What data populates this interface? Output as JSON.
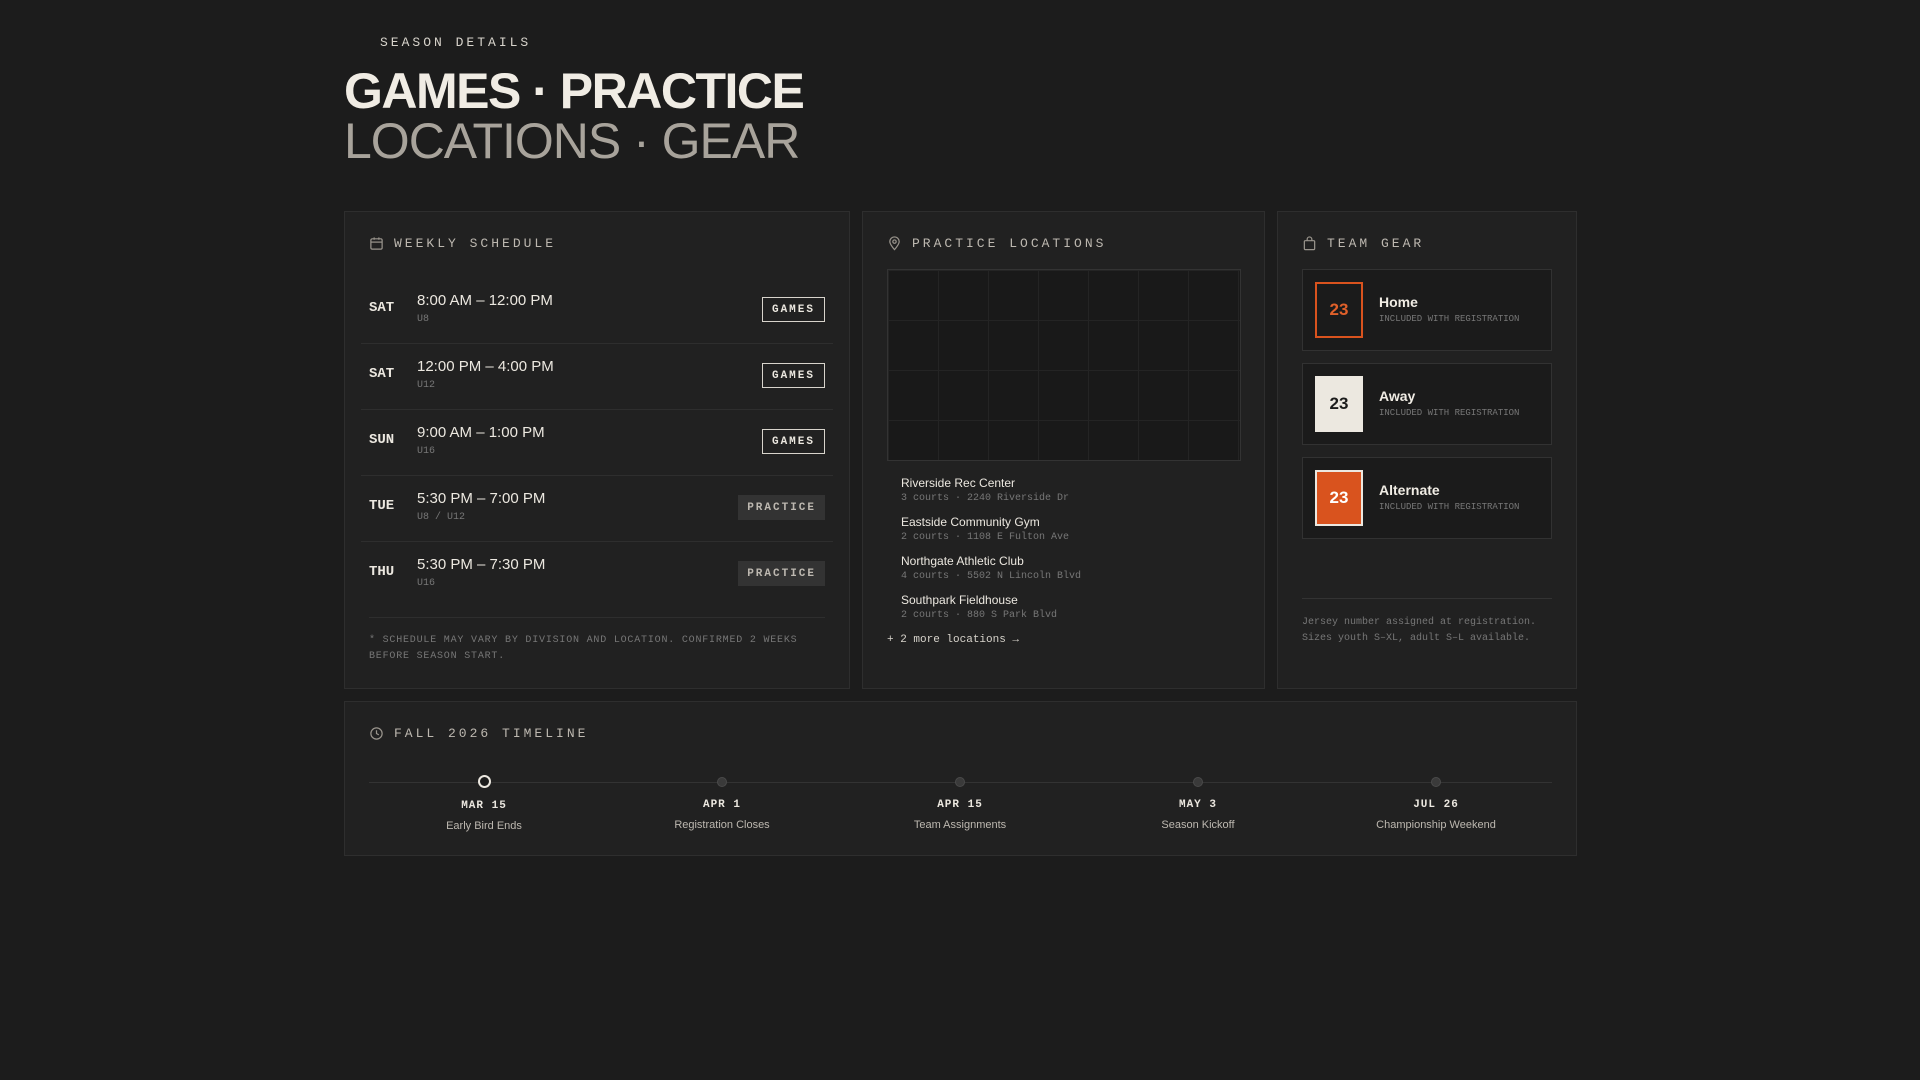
{
  "header": {
    "eyebrow": "SEASON DETAILS",
    "title_line1": "GAMES · PRACTICE",
    "title_line2": "LOCATIONS · GEAR"
  },
  "schedule": {
    "heading": "WEEKLY SCHEDULE",
    "icon": "calendar-icon",
    "rows": [
      {
        "day": "SAT",
        "time": "8:00 AM – 12:00 PM",
        "division": "U8",
        "tag": "GAMES"
      },
      {
        "day": "SAT",
        "time": "12:00 PM – 4:00 PM",
        "division": "U12",
        "tag": "GAMES"
      },
      {
        "day": "SUN",
        "time": "9:00 AM – 1:00 PM",
        "division": "U16",
        "tag": "GAMES"
      },
      {
        "day": "TUE",
        "time": "5:30 PM – 7:00 PM",
        "division": "U8 / U12",
        "tag": "PRACTICE"
      },
      {
        "day": "THU",
        "time": "5:30 PM – 7:30 PM",
        "division": "U16",
        "tag": "PRACTICE"
      }
    ],
    "note": "* SCHEDULE MAY VARY BY DIVISION AND LOCATION. CONFIRMED 2 WEEKS BEFORE SEASON START."
  },
  "locations": {
    "heading": "PRACTICE LOCATIONS",
    "icon": "map-pin-icon",
    "items": [
      {
        "name": "Riverside Rec Center",
        "meta": "3 courts · 2240 Riverside Dr"
      },
      {
        "name": "Eastside Community Gym",
        "meta": "2 courts · 1108 E Fulton Ave"
      },
      {
        "name": "Northgate Athletic Club",
        "meta": "4 courts · 5502 N Lincoln Blvd"
      },
      {
        "name": "Southpark Fieldhouse",
        "meta": "2 courts · 880 S Park Blvd"
      }
    ],
    "more": "+ 2 more locations →"
  },
  "gear": {
    "heading": "TEAM GEAR",
    "icon": "bag-icon",
    "items": [
      {
        "number": "23",
        "name": "Home",
        "sub": "INCLUDED WITH REGISTRATION",
        "style": "home"
      },
      {
        "number": "23",
        "name": "Away",
        "sub": "INCLUDED WITH REGISTRATION",
        "style": "away"
      },
      {
        "number": "23",
        "name": "Alternate",
        "sub": "INCLUDED WITH REGISTRATION",
        "style": "alt"
      }
    ],
    "note": "Jersey number assigned at registration. Sizes youth S–XL, adult S–L available."
  },
  "timeline": {
    "heading": "FALL 2026 TIMELINE",
    "icon": "clock-icon",
    "steps": [
      {
        "date": "MAR 15",
        "label": "Early Bird Ends",
        "active": true
      },
      {
        "date": "APR 1",
        "label": "Registration Closes",
        "active": false
      },
      {
        "date": "APR 15",
        "label": "Team Assignments",
        "active": false
      },
      {
        "date": "MAY 3",
        "label": "Season Kickoff",
        "active": false
      },
      {
        "date": "JUL 26",
        "label": "Championship Weekend",
        "active": false
      }
    ]
  },
  "colors": {
    "background": "#1c1c1c",
    "card": "#212121",
    "accent_orange": "#d9531e",
    "text_primary": "#ece8e0",
    "text_muted": "#777777"
  }
}
